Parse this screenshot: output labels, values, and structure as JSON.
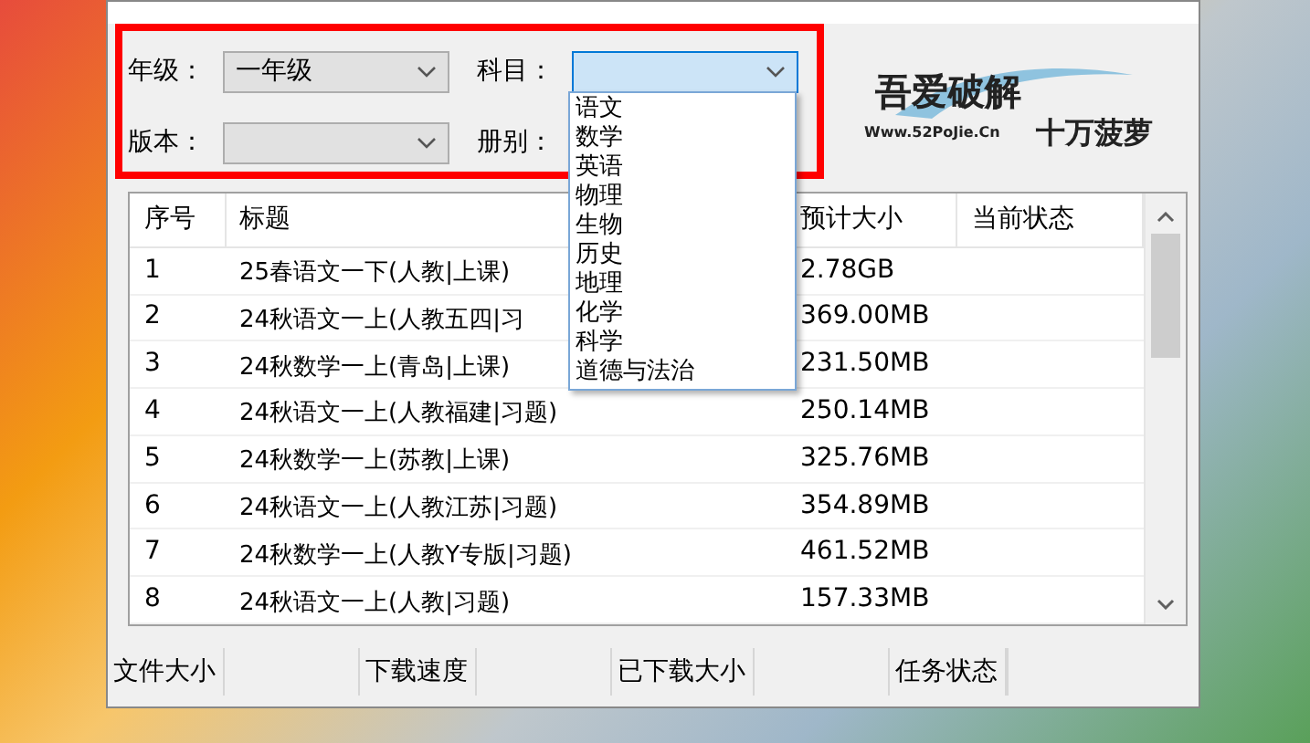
{
  "filters": [
    {
      "label": "年级：",
      "value": "一年级",
      "focused": false
    },
    {
      "label": "科目：",
      "focused": true,
      "open": true
    },
    {
      "label": "版本：",
      "focused": false
    },
    {
      "label": "册别："
    }
  ],
  "subject_options": [
    {
      "label": "语文",
      "selected": false
    },
    {
      "label": "数学",
      "selected": false
    },
    {
      "label": "英语",
      "selected": false
    },
    {
      "label": "物理",
      "selected": false
    },
    {
      "label": "生物",
      "selected": false
    },
    {
      "label": "历史",
      "selected": false
    },
    {
      "label": "地理",
      "selected": false
    },
    {
      "label": "化学",
      "selected": false
    },
    {
      "label": "科学",
      "selected": false
    },
    {
      "label": "道德与法治",
      "selected": false
    }
  ],
  "logo": {
    "mark": "吾爱破解",
    "url": "Www.52PoJie.Cn",
    "slogan": "十万菠萝"
  },
  "table": {
    "columns": [
      "序号",
      "标题",
      "预计大小",
      "当前状态"
    ],
    "rows": [
      {
        "no": "1",
        "title": "25春语文一下(人教|上课)",
        "size": "2.78GB"
      },
      {
        "no": "2",
        "title": "24秋语文一上(人教五四|习",
        "size": "369.00MB"
      },
      {
        "no": "3",
        "title": "24秋数学一上(青岛|上课)",
        "size": "231.50MB"
      },
      {
        "no": "4",
        "title": "24秋语文一上(人教福建|习题)",
        "size": "250.14MB"
      },
      {
        "no": "5",
        "title": "24秋数学一上(苏教|上课)",
        "size": "325.76MB"
      },
      {
        "no": "6",
        "title": "24秋语文一上(人教江苏|习题)",
        "size": "354.89MB"
      },
      {
        "no": "7",
        "title": "24秋数学一上(人教Y专版|习题)",
        "size": "461.52MB"
      },
      {
        "no": "8",
        "title": "24秋语文一上(人教|习题)",
        "size": "157.33MB"
      }
    ]
  },
  "status_bar": [
    "文件大小",
    "下载速度",
    "已下载大小",
    "任务状态"
  ]
}
